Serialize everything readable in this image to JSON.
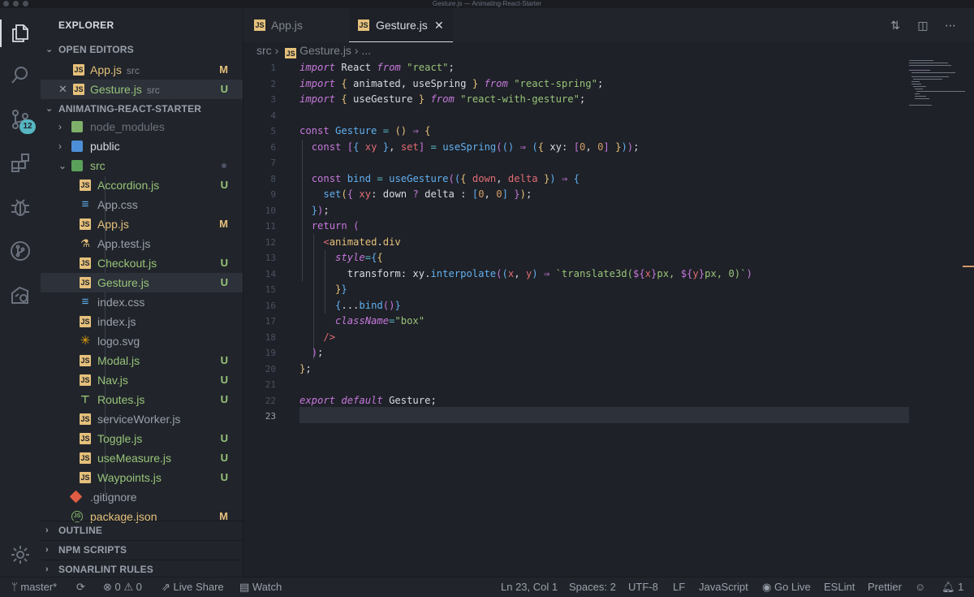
{
  "window": {
    "title": "Gesture.js — Animating-React-Starter"
  },
  "activity": {
    "scm_badge": "12"
  },
  "sidebar": {
    "title": "EXPLORER",
    "open_editors": {
      "header": "OPEN EDITORS",
      "items": [
        {
          "name": "App.js",
          "folder": "src",
          "status": "M"
        },
        {
          "name": "Gesture.js",
          "folder": "src",
          "status": "U"
        }
      ]
    },
    "project": {
      "header": "ANIMATING-REACT-STARTER",
      "folders": [
        {
          "name": "node_modules"
        },
        {
          "name": "public"
        },
        {
          "name": "src"
        }
      ],
      "src_files": [
        {
          "name": "Accordion.js",
          "status": "U"
        },
        {
          "name": "App.css",
          "status": ""
        },
        {
          "name": "App.js",
          "status": "M"
        },
        {
          "name": "App.test.js",
          "status": ""
        },
        {
          "name": "Checkout.js",
          "status": "U"
        },
        {
          "name": "Gesture.js",
          "status": "U"
        },
        {
          "name": "index.css",
          "status": ""
        },
        {
          "name": "index.js",
          "status": ""
        },
        {
          "name": "logo.svg",
          "status": ""
        },
        {
          "name": "Modal.js",
          "status": "U"
        },
        {
          "name": "Nav.js",
          "status": "U"
        },
        {
          "name": "Routes.js",
          "status": "U"
        },
        {
          "name": "serviceWorker.js",
          "status": ""
        },
        {
          "name": "Toggle.js",
          "status": "U"
        },
        {
          "name": "useMeasure.js",
          "status": "U"
        },
        {
          "name": "Waypoints.js",
          "status": "U"
        }
      ],
      "root_files": [
        {
          "name": ".gitignore",
          "status": ""
        },
        {
          "name": "package.json",
          "status": "M"
        }
      ]
    },
    "outline": "OUTLINE",
    "npm_scripts": "NPM SCRIPTS",
    "sonarlint": "SONARLINT RULES"
  },
  "tabs": [
    {
      "label": "App.js"
    },
    {
      "label": "Gesture.js",
      "close": "✕"
    }
  ],
  "breadcrumb": {
    "folder": "src",
    "file": "Gesture.js",
    "more": "..."
  },
  "editor": {
    "line_numbers": [
      "1",
      "2",
      "3",
      "4",
      "5",
      "6",
      "7",
      "8",
      "9",
      "10",
      "11",
      "12",
      "13",
      "14",
      "15",
      "16",
      "17",
      "18",
      "19",
      "20",
      "21",
      "22",
      "23"
    ]
  },
  "statusbar": {
    "branch": "master*",
    "problems_errors": "0",
    "problems_warnings": "0",
    "live_share": "Live Share",
    "watch": "Watch",
    "cursor": "Ln 23, Col 1",
    "spaces": "Spaces: 2",
    "encoding": "UTF-8",
    "eol": "LF",
    "language": "JavaScript",
    "go_live": "Go Live",
    "eslint": "ESLint",
    "prettier": "Prettier",
    "notifications": "1"
  },
  "colors": {
    "background": "#1e2127",
    "sidebar": "#21252b",
    "accent": "#56b6c2",
    "untracked": "#98c379",
    "modified": "#e5c07b"
  }
}
